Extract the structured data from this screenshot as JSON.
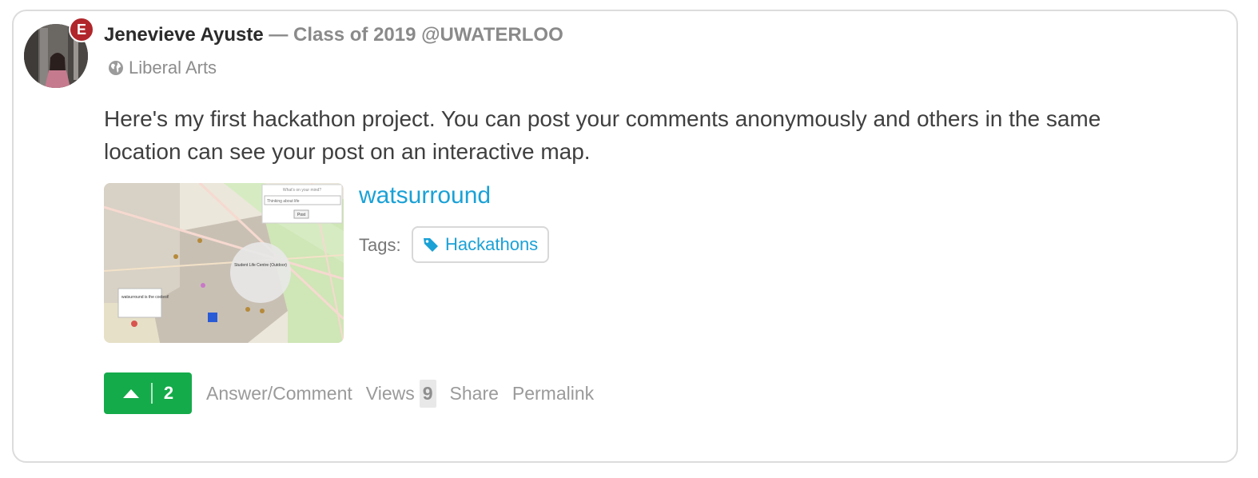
{
  "author": {
    "name": "Jenevieve Ayuste",
    "separator": "—",
    "credential": "Class of 2019 @UWATERLOO",
    "badge_letter": "E",
    "badge_color": "#b0262a"
  },
  "topic": {
    "icon": "globe-icon",
    "label": "Liberal Arts"
  },
  "post": {
    "text": "Here's my first hackathon project. You can post your comments anonymously and others in the same location can see your post on an interactive map."
  },
  "link_preview": {
    "title": "watsurround",
    "tags_label": "Tags:",
    "tags": [
      {
        "icon": "tag-icon",
        "label": "Hackathons"
      }
    ],
    "thumbnail": {
      "prompt_label": "What's on your mind?",
      "input_text": "Thinking about life",
      "post_button": "Post",
      "popup_text": "watsurround is the coolest!",
      "marker_text": "Student Life Centre (Outdoor)"
    }
  },
  "actions": {
    "upvote_count": "2",
    "upvote_color": "#14ab4a",
    "answer_comment": "Answer/Comment",
    "views_label": "Views",
    "views_count": "9",
    "share": "Share",
    "permalink": "Permalink"
  },
  "colors": {
    "link": "#1aa1d6",
    "muted": "#9a9a9a"
  }
}
